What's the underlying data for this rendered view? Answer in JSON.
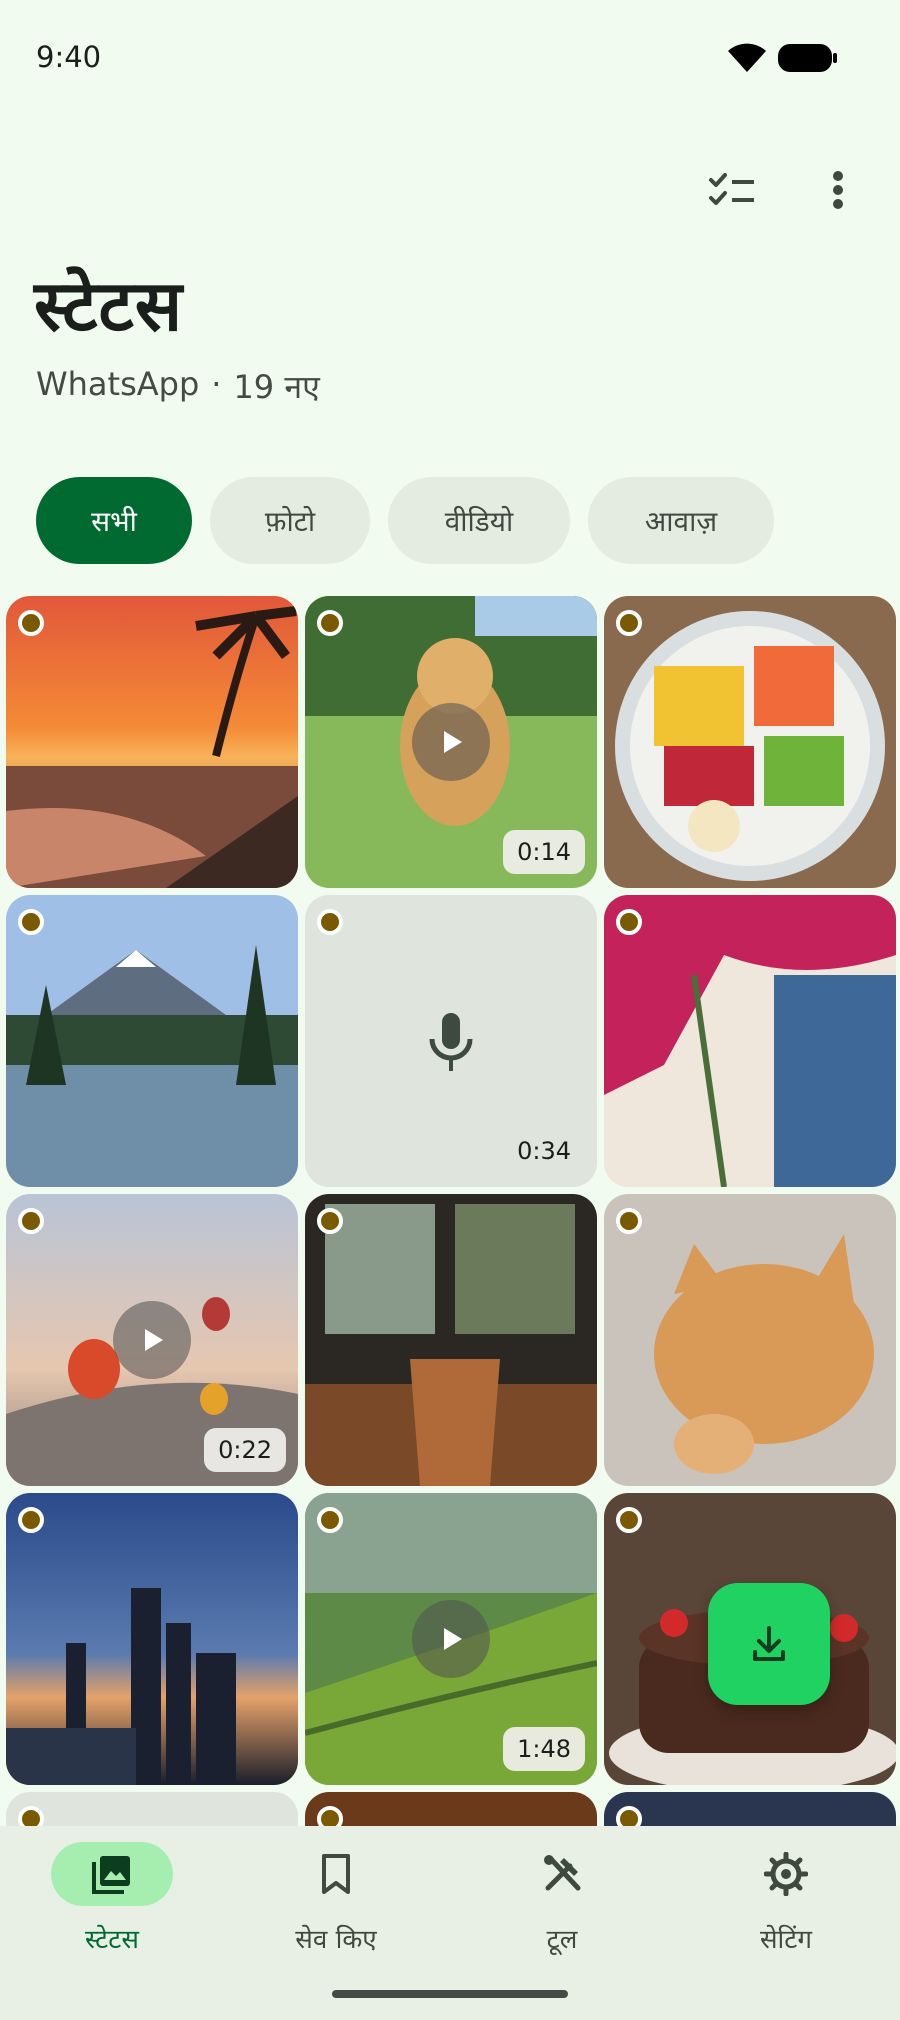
{
  "status_bar": {
    "time": "9:40"
  },
  "header": {
    "title": "स्टेटस",
    "app_name": "WhatsApp",
    "separator": "·",
    "new_count": "19 नए",
    "icons": [
      "checklist-icon",
      "more-vert-icon"
    ]
  },
  "filters": {
    "chips": [
      {
        "label": "सभी",
        "selected": true
      },
      {
        "label": "फ़ोटो",
        "selected": false
      },
      {
        "label": "वीडियो",
        "selected": false
      },
      {
        "label": "आवाज़",
        "selected": false
      }
    ]
  },
  "grid": {
    "tiles": [
      {
        "kind": "photo",
        "subject": "sunset-beach"
      },
      {
        "kind": "video",
        "subject": "puppy-running",
        "duration": "0:14"
      },
      {
        "kind": "photo",
        "subject": "fruit-bowl"
      },
      {
        "kind": "photo",
        "subject": "mountain-lake"
      },
      {
        "kind": "audio",
        "duration": "0:34"
      },
      {
        "kind": "photo",
        "subject": "flowers-blue-door"
      },
      {
        "kind": "video",
        "subject": "hot-air-balloons",
        "duration": "0:22"
      },
      {
        "kind": "photo",
        "subject": "tea-glass-window"
      },
      {
        "kind": "photo",
        "subject": "sleeping-kitten"
      },
      {
        "kind": "photo",
        "subject": "city-skyline-dusk"
      },
      {
        "kind": "video",
        "subject": "rice-terraces",
        "duration": "1:48"
      },
      {
        "kind": "photo",
        "subject": "birthday-cake"
      }
    ]
  },
  "fab": {
    "icon": "download-icon"
  },
  "bottom_nav": {
    "items": [
      {
        "label": "स्टेटस",
        "icon": "photo-library-icon",
        "active": true
      },
      {
        "label": "सेव किए",
        "icon": "bookmark-icon",
        "active": false
      },
      {
        "label": "टूल",
        "icon": "tools-icon",
        "active": false
      },
      {
        "label": "सेटिंग",
        "icon": "gear-icon",
        "active": false
      }
    ]
  },
  "colors": {
    "background": "#f2fbef",
    "accent": "#006a31",
    "fab": "#20d261",
    "nav_active_pill": "#a6eeb0"
  }
}
